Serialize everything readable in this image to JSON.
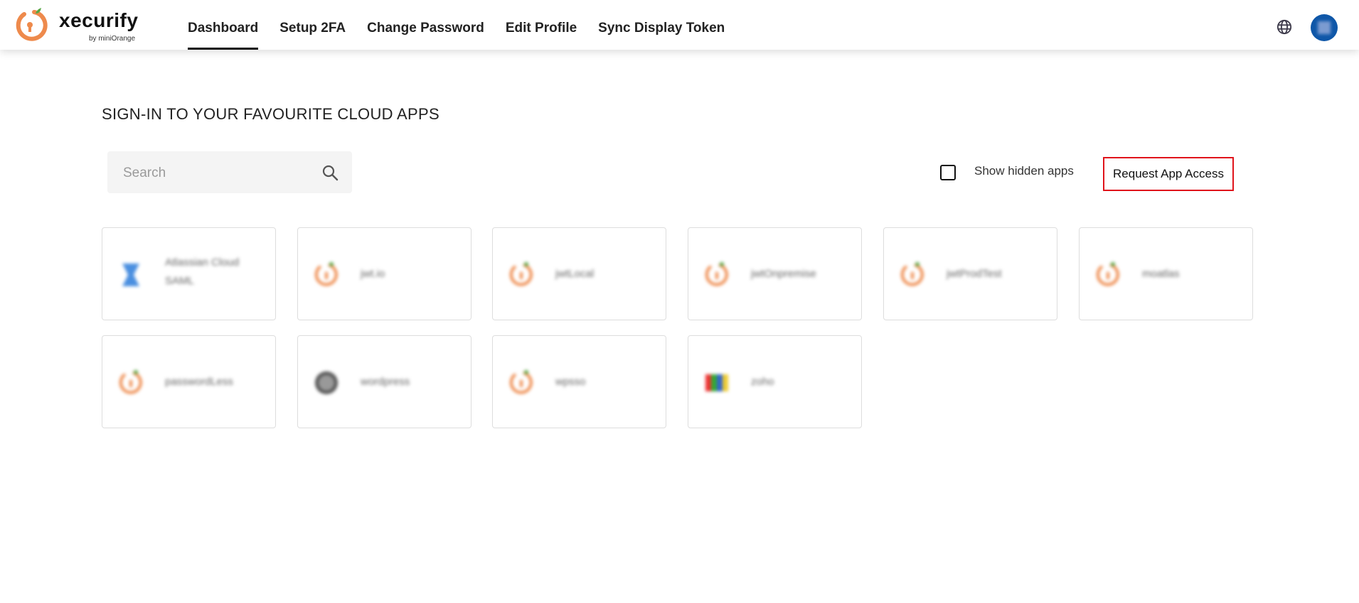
{
  "brand": {
    "name": "xecurify",
    "sub": "by miniOrange"
  },
  "nav": [
    {
      "label": "Dashboard",
      "active": true
    },
    {
      "label": "Setup 2FA"
    },
    {
      "label": "Change Password"
    },
    {
      "label": "Edit Profile"
    },
    {
      "label": "Sync Display Token"
    }
  ],
  "page": {
    "title": "SIGN-IN TO YOUR FAVOURITE CLOUD APPS"
  },
  "search": {
    "placeholder": "Search",
    "value": ""
  },
  "filters": {
    "show_hidden_label": "Show hidden apps",
    "show_hidden_checked": false
  },
  "request_button": "Request App Access",
  "colors": {
    "accent": "#e0141b",
    "avatar": "#0f57a8",
    "miniorange": "#ee8a4c"
  },
  "apps": [
    {
      "name": "Atlassian Cloud SAML",
      "icon": "atlassian-icon"
    },
    {
      "name": "jwt.io",
      "icon": "miniorange-icon"
    },
    {
      "name": "jwtLocal",
      "icon": "miniorange-icon"
    },
    {
      "name": "jwtOnpremise",
      "icon": "miniorange-icon"
    },
    {
      "name": "jwtProdTest",
      "icon": "miniorange-icon"
    },
    {
      "name": "moatlas",
      "icon": "miniorange-icon"
    },
    {
      "name": "passwordLess",
      "icon": "miniorange-icon"
    },
    {
      "name": "wordpress",
      "icon": "wordpress-icon"
    },
    {
      "name": "wpsso",
      "icon": "miniorange-icon"
    },
    {
      "name": "zoho",
      "icon": "zoho-icon"
    }
  ]
}
